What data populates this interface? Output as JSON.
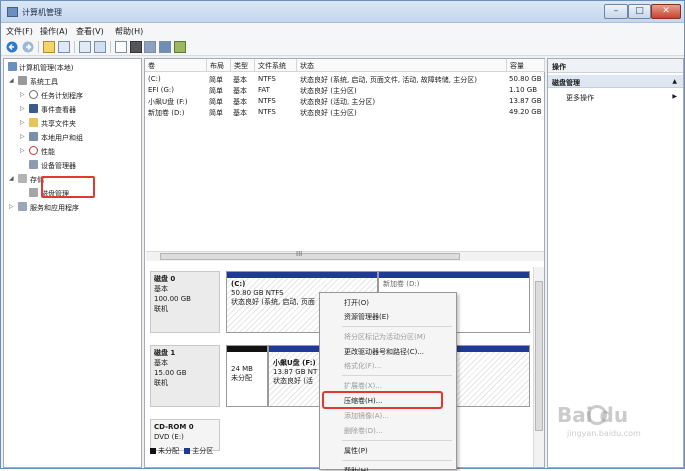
{
  "window": {
    "title": "计算机管理"
  },
  "menus": [
    "文件(F)",
    "操作(A)",
    "查看(V)",
    "帮助(H)"
  ],
  "tree": [
    {
      "label": "计算机管理(本地)",
      "arrow": ""
    },
    {
      "label": "系统工具",
      "arrow": "◢"
    },
    {
      "label": "任务计划程序",
      "arrow": "▷"
    },
    {
      "label": "事件查看器",
      "arrow": "▷"
    },
    {
      "label": "共享文件夹",
      "arrow": "▷"
    },
    {
      "label": "本地用户和组",
      "arrow": "▷"
    },
    {
      "label": "性能",
      "arrow": "▷"
    },
    {
      "label": "设备管理器",
      "arrow": ""
    },
    {
      "label": "存储",
      "arrow": "◢"
    },
    {
      "label": "磁盘管理",
      "arrow": ""
    },
    {
      "label": "服务和应用程序",
      "arrow": "▷"
    }
  ],
  "columns": [
    "卷",
    "布局",
    "类型",
    "文件系统",
    "状态",
    "容量"
  ],
  "volumes": [
    {
      "name": "(C:)",
      "layout": "简单",
      "type": "基本",
      "fs": "NTFS",
      "status": "状态良好 (系统, 启动, 页面文件, 活动, 故障转储, 主分区)",
      "capacity": "50.80 GB"
    },
    {
      "name": "EFI (G:)",
      "layout": "简单",
      "type": "基本",
      "fs": "FAT",
      "status": "状态良好 (主分区)",
      "capacity": "1.10 GB"
    },
    {
      "name": "小飙U盘 (F:)",
      "layout": "简单",
      "type": "基本",
      "fs": "NTFS",
      "status": "状态良好 (活动, 主分区)",
      "capacity": "13.87 GB"
    },
    {
      "name": "新加卷 (D:)",
      "layout": "简单",
      "type": "基本",
      "fs": "NTFS",
      "status": "状态良好 (主分区)",
      "capacity": "49.20 GB"
    }
  ],
  "scroll_grip": "III",
  "disks": [
    {
      "name": "磁盘 0",
      "type": "基本",
      "size": "100.00 GB",
      "state": "联机"
    },
    {
      "name": "磁盘 1",
      "type": "基本",
      "size": "15.00 GB",
      "state": "联机"
    },
    {
      "name": "CD-ROM 0",
      "type": "DVD (E:)",
      "size": "",
      "state": ""
    }
  ],
  "partitions": {
    "c": {
      "label": "(C:)",
      "size": "50.80 GB NTFS",
      "status": "状态良好 (系统, 启动, 页面"
    },
    "d_clip": "新加卷 (D:)",
    "unalloc": {
      "size": "24 MB",
      "status": "未分配"
    },
    "usb": {
      "label": "小飙U盘 (F:)",
      "size": "13.87 GB NT",
      "status": "状态良好 (活"
    }
  },
  "legend": {
    "unallocated": "未分配",
    "primary": "主分区"
  },
  "actions": {
    "header": "操作",
    "selected": "磁盘管理",
    "more": "更多操作"
  },
  "context_menu": [
    {
      "label": "打开(O)",
      "enabled": true
    },
    {
      "label": "资源管理器(E)",
      "enabled": true
    },
    {
      "label": "将分区标记为活动分区(M)",
      "enabled": false
    },
    {
      "label": "更改驱动器号和路径(C)...",
      "enabled": true
    },
    {
      "label": "格式化(F)...",
      "enabled": false
    },
    {
      "label": "扩展卷(X)...",
      "enabled": false
    },
    {
      "label": "压缩卷(H)...",
      "enabled": true
    },
    {
      "label": "添加镜像(A)...",
      "enabled": false
    },
    {
      "label": "删除卷(D)...",
      "enabled": false
    },
    {
      "label": "属性(P)",
      "enabled": true
    },
    {
      "label": "帮助(H)",
      "enabled": true
    }
  ],
  "watermark": {
    "brand": "Bai du",
    "url": "jingyan.baidu.com"
  },
  "colors": {
    "primary_partition": "#1f3a93",
    "unallocated": "#111111",
    "highlight": "#e03a2f"
  }
}
